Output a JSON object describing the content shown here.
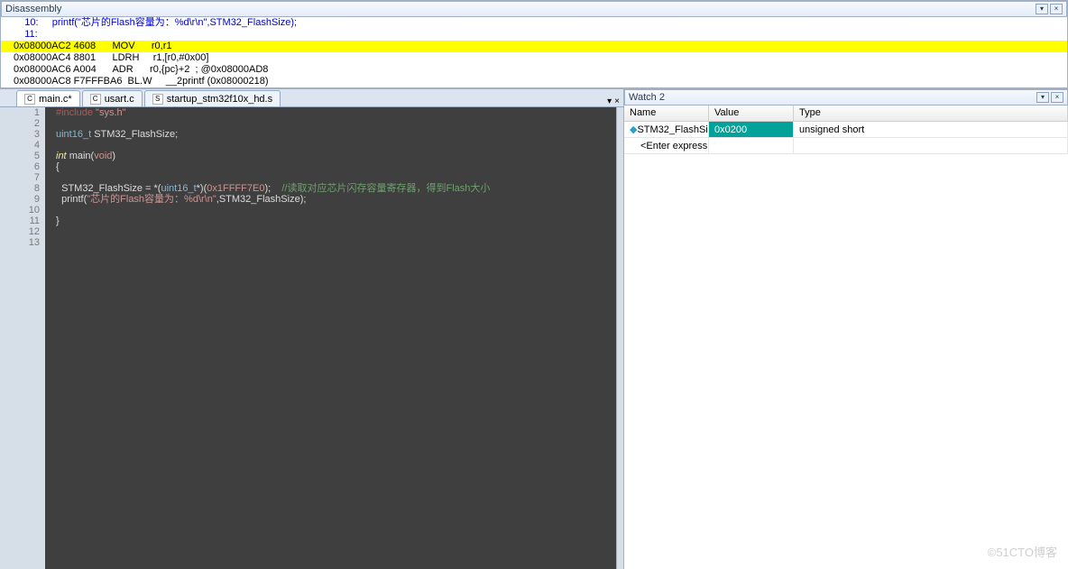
{
  "disasm": {
    "title": "Disassembly",
    "rows": [
      {
        "hl": false,
        "gutter": "",
        "text": "    10:     printf(\"芯片的Flash容量为：%d\\r\\n\",STM32_FlashSize); "
      },
      {
        "hl": false,
        "gutter": "",
        "text": "    11:  "
      },
      {
        "hl": true,
        "gutter": "",
        "text": "0x08000AC2 4608      MOV      r0,r1"
      },
      {
        "hl": false,
        "gutter": "",
        "text": "0x08000AC4 8801      LDRH     r1,[r0,#0x00]"
      },
      {
        "hl": false,
        "gutter": "",
        "text": "0x08000AC6 A004      ADR      r0,{pc}+2  ; @0x08000AD8"
      },
      {
        "hl": false,
        "gutter": "",
        "text": "0x08000AC8 F7FFFBA6  BL.W     __2printf (0x08000218)"
      }
    ]
  },
  "tabs": [
    {
      "label": "main.c*",
      "active": true,
      "icon": "C"
    },
    {
      "label": "usart.c",
      "active": false,
      "icon": "C"
    },
    {
      "label": "startup_stm32f10x_hd.s",
      "active": false,
      "icon": "S"
    }
  ],
  "editor": {
    "lines": [
      "1",
      "2",
      "3",
      "4",
      "5",
      "6",
      "7",
      "8",
      "9",
      "10",
      "11",
      "12",
      "13"
    ]
  },
  "code": {
    "l1_pp": "#include",
    "l1_str": " \"sys.h\"",
    "l3_type": "uint16_t ",
    "l3_var": "STM32_FlashSize",
    "l3_p": ";",
    "l5_kw": "int ",
    "l5_fn": "main",
    "l5_p1": "(",
    "l5_void": "void",
    "l5_p2": ")",
    "l6": "{",
    "l7": "",
    "l8_var": "  STM32_FlashSize ",
    "l8_eq": "= *(",
    "l8_type": "uint16_t",
    "l8_star": "*)(",
    "l8_hex": "0x1FFFF7E0",
    "l8_end": ");    ",
    "l8_comm": "//读取对应芯片闪存容量寄存器，得到Flash大小",
    "l9_fn": "  printf",
    "l9_p1": "(",
    "l9_str": "\"芯片的Flash容量为：%d\\r\\n\"",
    "l9_mid": ",",
    "l9_var": "STM32_FlashSize",
    "l9_p2": ");",
    "l11": "}"
  },
  "watch": {
    "title": "Watch 2",
    "head_name": "Name",
    "head_value": "Value",
    "head_type": "Type",
    "rows": [
      {
        "name": "STM32_FlashSi...",
        "value": "0x0200",
        "type": "unsigned short",
        "hi": true
      },
      {
        "name": "<Enter expression>",
        "value": "",
        "type": "",
        "hi": false
      }
    ]
  },
  "watermark": "©51CTO博客"
}
